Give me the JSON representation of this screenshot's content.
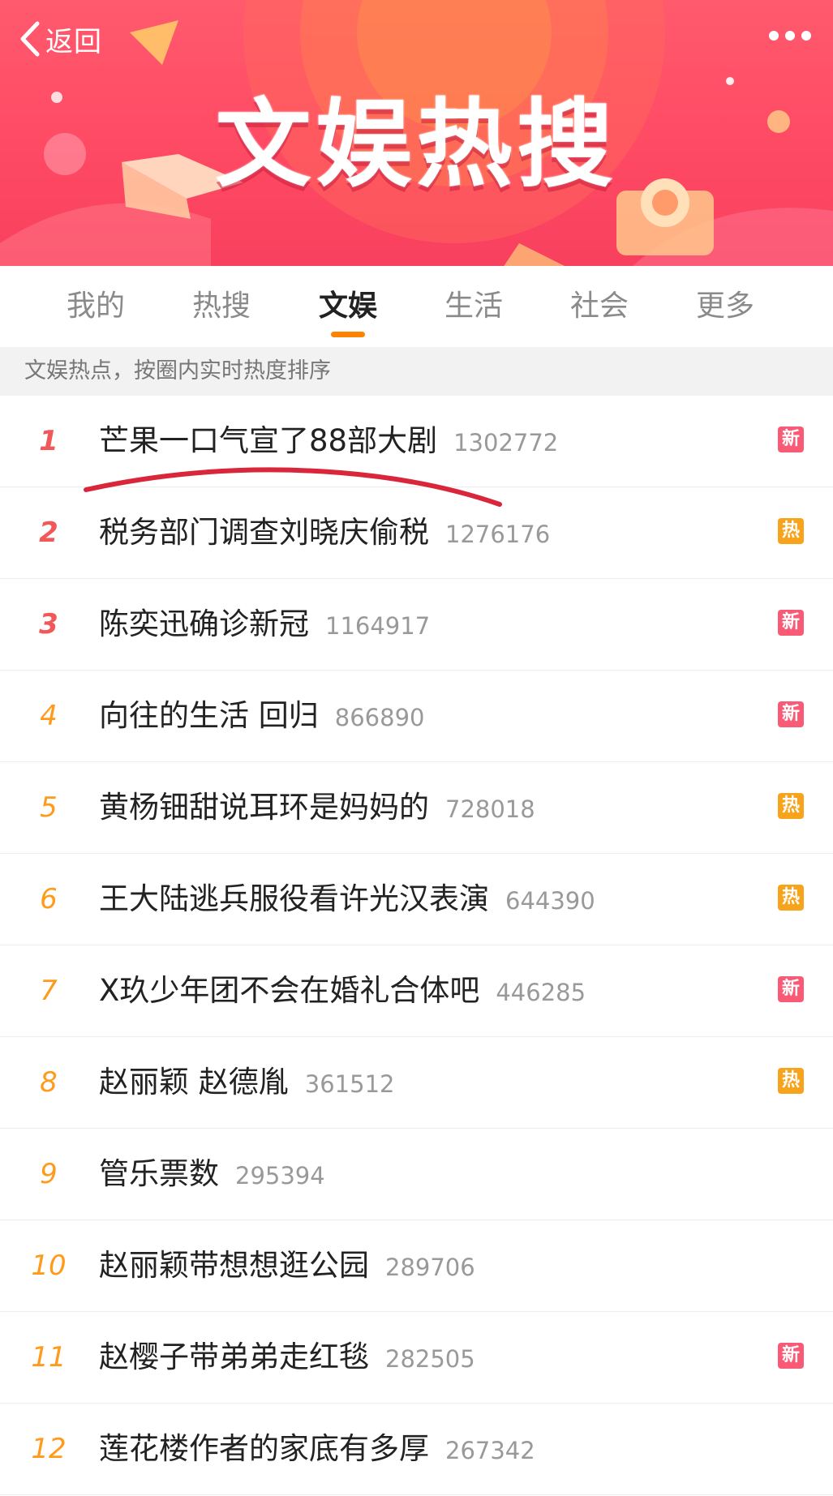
{
  "nav": {
    "back_label": "返回",
    "title": "文娱热搜"
  },
  "tabs": [
    {
      "label": "我的",
      "active": false
    },
    {
      "label": "热搜",
      "active": false
    },
    {
      "label": "文娱",
      "active": true
    },
    {
      "label": "生活",
      "active": false
    },
    {
      "label": "社会",
      "active": false
    },
    {
      "label": "更多",
      "active": false
    }
  ],
  "subheader": "文娱热点，按圈内实时热度排序",
  "colors": {
    "new_badge": "#f95a75",
    "hot_badge": "#f7a41c",
    "accent": "#ff8200",
    "banner": "#ff4a64",
    "annotation_underline": "#d9263a"
  },
  "list": [
    {
      "rank": "1",
      "title": "芒果一口气宣了88部大剧",
      "count": "1302772",
      "badge": "新",
      "badge_type": "new"
    },
    {
      "rank": "2",
      "title": "税务部门调查刘晓庆偷税",
      "count": "1276176",
      "badge": "热",
      "badge_type": "hot"
    },
    {
      "rank": "3",
      "title": "陈奕迅确诊新冠",
      "count": "1164917",
      "badge": "新",
      "badge_type": "new"
    },
    {
      "rank": "4",
      "title": "向往的生活 回归",
      "count": "866890",
      "badge": "新",
      "badge_type": "new"
    },
    {
      "rank": "5",
      "title": "黄杨钿甜说耳环是妈妈的",
      "count": "728018",
      "badge": "热",
      "badge_type": "hot"
    },
    {
      "rank": "6",
      "title": "王大陆逃兵服役看许光汉表演",
      "count": "644390",
      "badge": "热",
      "badge_type": "hot"
    },
    {
      "rank": "7",
      "title": "X玖少年团不会在婚礼合体吧",
      "count": "446285",
      "badge": "新",
      "badge_type": "new"
    },
    {
      "rank": "8",
      "title": "赵丽颖 赵德胤",
      "count": "361512",
      "badge": "热",
      "badge_type": "hot"
    },
    {
      "rank": "9",
      "title": "管乐票数",
      "count": "295394",
      "badge": "",
      "badge_type": "none"
    },
    {
      "rank": "10",
      "title": "赵丽颖带想想逛公园",
      "count": "289706",
      "badge": "",
      "badge_type": "none"
    },
    {
      "rank": "11",
      "title": "赵樱子带弟弟走红毯",
      "count": "282505",
      "badge": "新",
      "badge_type": "new"
    },
    {
      "rank": "12",
      "title": "莲花楼作者的家底有多厚",
      "count": "267342",
      "badge": "",
      "badge_type": "none"
    }
  ]
}
